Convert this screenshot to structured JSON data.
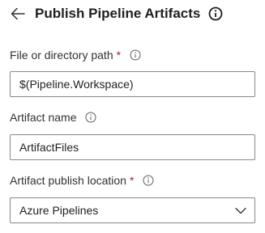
{
  "header": {
    "title": "Publish Pipeline Artifacts",
    "back_icon": "arrow-left-icon",
    "info_icon": "info-circle-icon"
  },
  "fields": {
    "path": {
      "label": "File or directory path",
      "required_mark": "*",
      "value": "$(Pipeline.Workspace)"
    },
    "artifact_name": {
      "label": "Artifact name",
      "value": "ArtifactFiles"
    },
    "publish_location": {
      "label": "Artifact publish location",
      "required_mark": "*",
      "selected": "Azure Pipelines"
    }
  },
  "colors": {
    "text": "#201f1e",
    "label": "#323130",
    "required": "#a4262c",
    "border": "#8a8886"
  }
}
